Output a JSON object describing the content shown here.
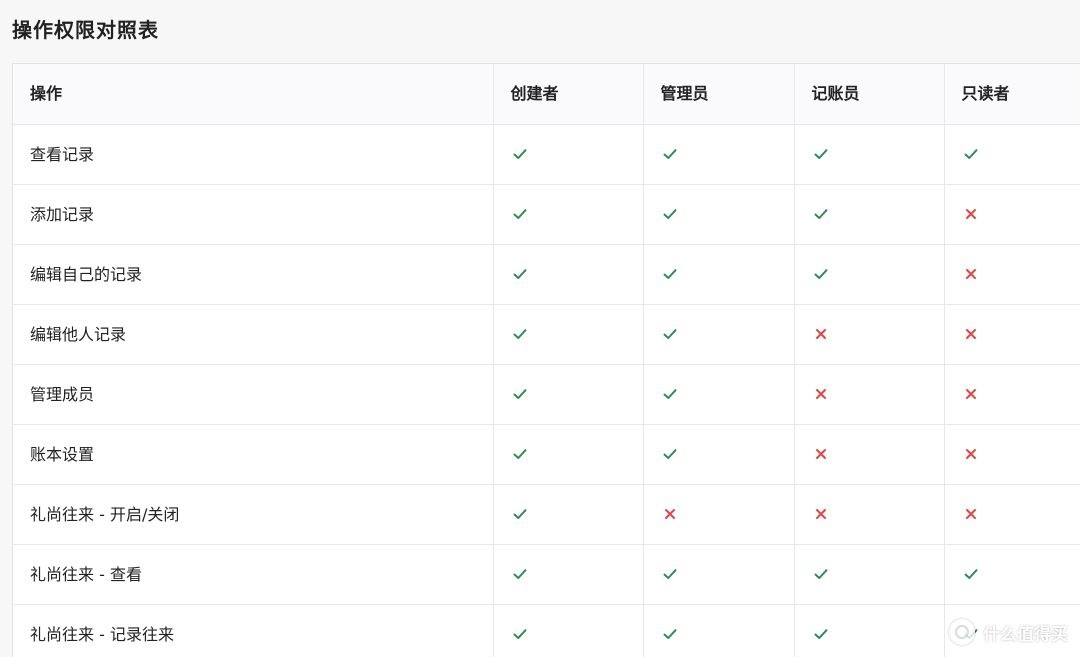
{
  "title": "操作权限对照表",
  "table": {
    "headers": [
      "操作",
      "创建者",
      "管理员",
      "记账员",
      "只读者"
    ],
    "rows": [
      {
        "label": "查看记录",
        "perms": [
          true,
          true,
          true,
          true
        ]
      },
      {
        "label": "添加记录",
        "perms": [
          true,
          true,
          true,
          false
        ]
      },
      {
        "label": "编辑自己的记录",
        "perms": [
          true,
          true,
          true,
          false
        ]
      },
      {
        "label": "编辑他人记录",
        "perms": [
          true,
          true,
          false,
          false
        ]
      },
      {
        "label": "管理成员",
        "perms": [
          true,
          true,
          false,
          false
        ]
      },
      {
        "label": "账本设置",
        "perms": [
          true,
          true,
          false,
          false
        ]
      },
      {
        "label": "礼尚往来 - 开启/关闭",
        "perms": [
          true,
          false,
          false,
          false
        ]
      },
      {
        "label": "礼尚往来 - 查看",
        "perms": [
          true,
          true,
          true,
          true
        ]
      },
      {
        "label": "礼尚往来 - 记录往来",
        "perms": [
          true,
          true,
          true,
          true
        ]
      }
    ]
  },
  "icons": {
    "allowed": "check-icon",
    "denied": "cross-icon"
  },
  "colors": {
    "check": "#2e8b57",
    "cross": "#e04646",
    "header_bg": "#fafafc",
    "border": "#e8e8ec"
  },
  "watermark": {
    "text": "什么值得买"
  }
}
